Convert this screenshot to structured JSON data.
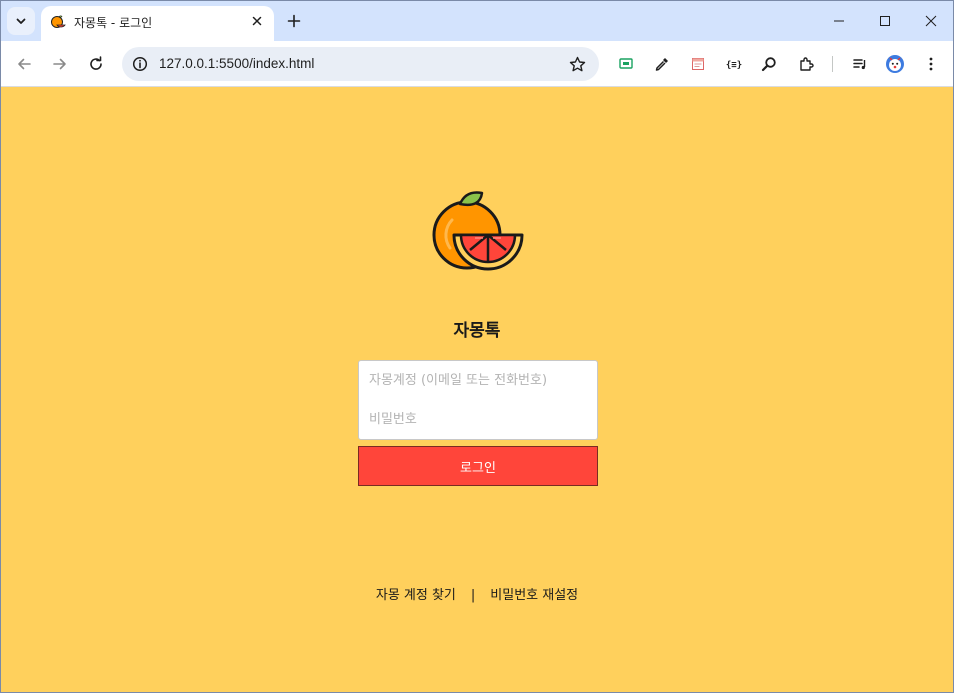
{
  "browser": {
    "tab_title": "자몽톡 - 로그인",
    "url": "127.0.0.1:5500/index.html"
  },
  "login": {
    "app_name": "자몽톡",
    "account_placeholder": "자몽계정 (이메일 또는 전화번호)",
    "password_placeholder": "비밀번호",
    "login_label": "로그인"
  },
  "footer": {
    "find_account": "자몽 계정 찾기",
    "separator": "|",
    "reset_password": "비밀번호 재설정"
  },
  "colors": {
    "page_background": "#ffd05c",
    "login_button": "#ff453a",
    "tabstrip": "#d3e3fd"
  }
}
